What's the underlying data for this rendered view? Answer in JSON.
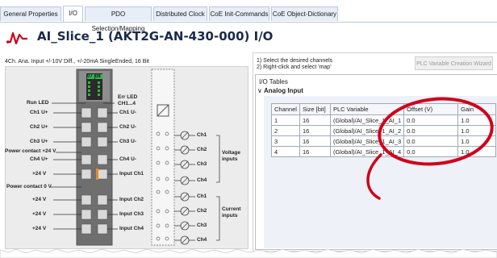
{
  "tabs": [
    {
      "label": "General Properties",
      "active": false
    },
    {
      "label": "I/O",
      "active": true
    },
    {
      "label": "PDO Selection/Mapping",
      "active": false
    },
    {
      "label": "Distributed Clock",
      "active": false
    },
    {
      "label": "CoE Init-Commands",
      "active": false
    },
    {
      "label": "CoE Object-Dictionary",
      "active": false
    }
  ],
  "header": {
    "title": "AI_Slice_1 (AKT2G-AN-430-000) I/O",
    "description": "4Ch. Ana. Input +/-10V Diff., +/-20mA SingleEnded, 16 Bit",
    "icon": "signal-wave-icon"
  },
  "device": {
    "status_leds": [
      "07",
      "08"
    ],
    "left_labels": {
      "run_led": "Run LED",
      "ch1u_plus": "Ch1 U+",
      "ch2u_plus": "Ch2 U+",
      "ch3u_plus": "Ch3 U+",
      "power_contact_24": "Power contact +24 V",
      "ch4u_plus": "Ch4 U+",
      "plus24_1": "+24 V",
      "power_contact_0": "Power contact 0 V",
      "plus24_2": "+24 V",
      "plus24_3": "+24 V",
      "plus24_4": "+24 V"
    },
    "mid_labels": {
      "err_led_1": "Err LED",
      "err_led_2": "CH1...4",
      "ch1u_minus": "Ch1 U-",
      "ch2u_minus": "Ch2 U-",
      "ch3u_minus": "Ch3 U-",
      "ch4u_minus": "Ch4 U-",
      "input_ch1": "Input Ch1",
      "input_ch2": "Input Ch2",
      "input_ch3": "Input Ch3",
      "input_ch4": "Input Ch4"
    },
    "circuit_labels": {
      "ch1_v": "Ch1",
      "ch2_v": "Ch2",
      "ch3_v": "Ch3",
      "ch4_v": "Ch4",
      "ch1_c": "Ch1",
      "ch2_c": "Ch2",
      "ch3_c": "Ch3",
      "ch4_c": "Ch4",
      "voltage_1": "Voltage",
      "voltage_2": "inputs",
      "current_1": "Current",
      "current_2": "inputs"
    }
  },
  "panel": {
    "instruction_1": "1) Select the desired channels",
    "instruction_2": "2) Right-click and select 'map'",
    "wizard_button": "PLC Variable Creation Wizard",
    "io_tables_label": "I/O Tables",
    "group_label": "Analog Input"
  },
  "io_table": {
    "headers": [
      "Channel",
      "Size [bit]",
      "PLC Variable",
      "Offset (V)",
      "Gain"
    ],
    "rows": [
      [
        "1",
        "16",
        "(Global)/AI_Slice_1_AI_1",
        "0.0",
        "1.0"
      ],
      [
        "2",
        "16",
        "(Global)/AI_Slice_1_AI_2",
        "0.0",
        "1.0"
      ],
      [
        "3",
        "16",
        "(Global)/AI_Slice_1_AI_3",
        "0.0",
        "1.0"
      ],
      [
        "4",
        "16",
        "(Global)/AI_Slice_1_AI_4",
        "0.0",
        "1.0"
      ]
    ]
  },
  "colors": {
    "accent_red": "#d0021b",
    "title_text": "#1b2a4a",
    "led_green": "#2fb84a",
    "tab_bg": "#e7eef7"
  }
}
